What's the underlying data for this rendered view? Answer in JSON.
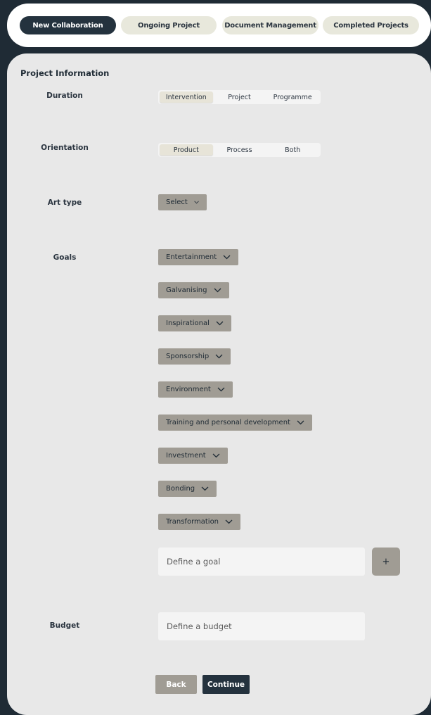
{
  "nav": {
    "tabs": [
      {
        "label": "New Collaboration",
        "active": true
      },
      {
        "label": "Ongoing Project",
        "active": false
      },
      {
        "label": "Document Management",
        "active": false
      },
      {
        "label": "Completed Projects",
        "active": false
      }
    ]
  },
  "form": {
    "title": "Project Information",
    "duration": {
      "label": "Duration",
      "options": [
        "Intervention",
        "Project",
        "Programme"
      ],
      "selected": "Intervention"
    },
    "orientation": {
      "label": "Orientation",
      "options": [
        "Product",
        "Process",
        "Both"
      ],
      "selected": "Product"
    },
    "art_type": {
      "label": "Art type",
      "value": "Select"
    },
    "goals": {
      "label": "Goals",
      "items": [
        "Entertainment",
        "Galvanising",
        "Inspirational",
        "Sponsorship",
        "Environment",
        "Training and personal development",
        "Investment",
        "Bonding",
        "Transformation"
      ],
      "define_placeholder": "Define a goal",
      "add_label": "+"
    },
    "budget": {
      "label": "Budget",
      "placeholder": "Define a budget"
    },
    "back_label": "Back",
    "continue_label": "Continue"
  },
  "colors": {
    "background": "#1f2b35",
    "active_tab": "#24323e",
    "tab": "#e8e8dc",
    "dropdown": "#a09c94",
    "panel": "#e8e8e8"
  }
}
